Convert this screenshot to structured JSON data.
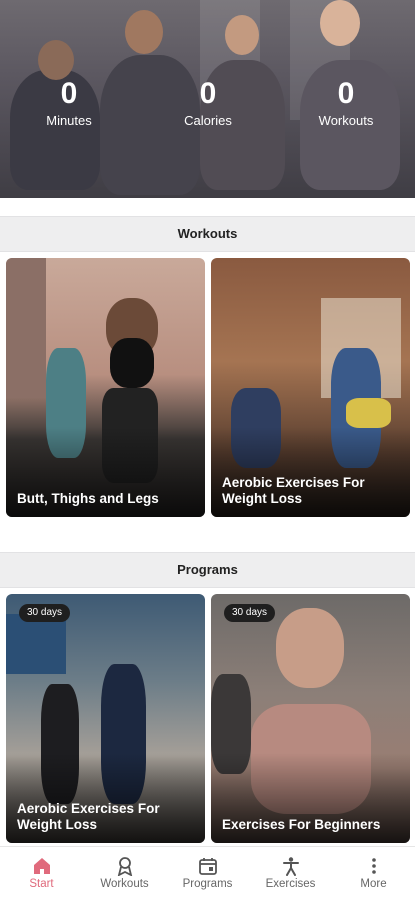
{
  "stats": [
    {
      "value": "0",
      "label": "Minutes"
    },
    {
      "value": "0",
      "label": "Calories"
    },
    {
      "value": "0",
      "label": "Workouts"
    }
  ],
  "sections": {
    "workouts": "Workouts",
    "programs": "Programs"
  },
  "workouts": [
    {
      "title": "Butt, Thighs and Legs"
    },
    {
      "title": "Aerobic Exercises For Weight Loss"
    }
  ],
  "programs": [
    {
      "badge": "30 days",
      "title": "Aerobic Exercises For Weight Loss"
    },
    {
      "badge": "30 days",
      "title": "Exercises For Beginners"
    }
  ],
  "nav": [
    {
      "label": "Start",
      "icon": "home-icon",
      "active": true
    },
    {
      "label": "Workouts",
      "icon": "medal-icon",
      "active": false
    },
    {
      "label": "Programs",
      "icon": "calendar-icon",
      "active": false
    },
    {
      "label": "Exercises",
      "icon": "person-icon",
      "active": false
    },
    {
      "label": "More",
      "icon": "more-vertical-icon",
      "active": false
    }
  ],
  "colors": {
    "accent": "#e06a7c"
  }
}
